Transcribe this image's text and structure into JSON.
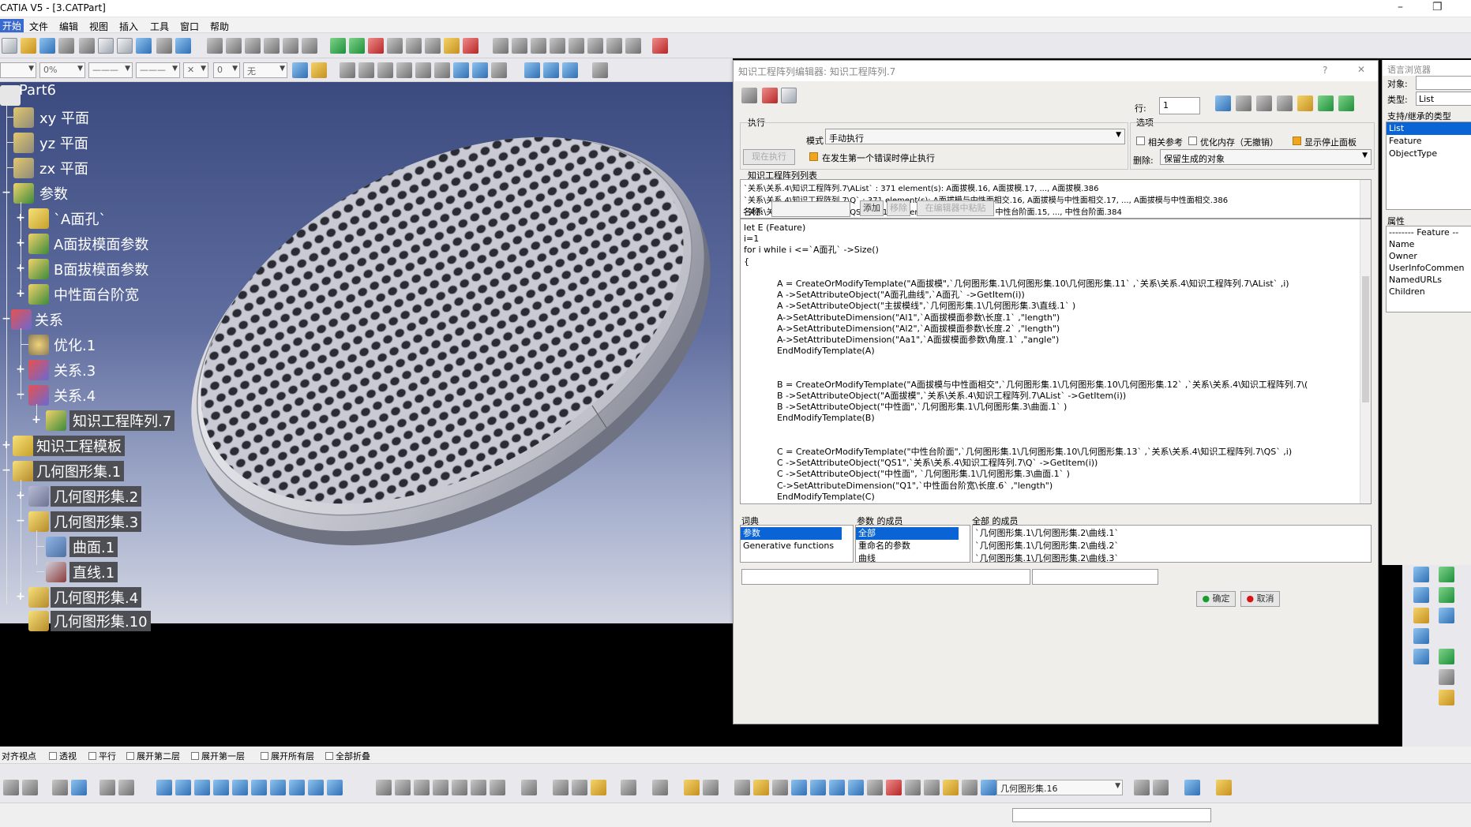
{
  "window": {
    "title": "CATIA V5 - [3.CATPart]"
  },
  "menu": [
    "开始",
    "文件",
    "编辑",
    "视图",
    "插入",
    "工具",
    "窗口",
    "帮助"
  ],
  "toolbar": {
    "opacity_value": "0%",
    "material_value": "无",
    "line_val": "0"
  },
  "tree": {
    "root": "Part6",
    "items": [
      {
        "label": "xy 平面"
      },
      {
        "label": "yz 平面"
      },
      {
        "label": "zx 平面"
      },
      {
        "label": "参数"
      },
      {
        "label": "`A面孔`"
      },
      {
        "label": "A面拔模面参数"
      },
      {
        "label": "B面拔模面参数"
      },
      {
        "label": "中性面台阶宽"
      },
      {
        "label": "关系"
      },
      {
        "label": "优化.1"
      },
      {
        "label": "关系.3"
      },
      {
        "label": "关系.4"
      },
      {
        "label": "知识工程阵列.7"
      },
      {
        "label": "知识工程模板"
      },
      {
        "label": "几何图形集.1"
      },
      {
        "label": "几何图形集.2"
      },
      {
        "label": "几何图形集.3"
      },
      {
        "label": "曲面.1"
      },
      {
        "label": "直线.1"
      },
      {
        "label": "几何图形集.4"
      },
      {
        "label": "几何图形集.10"
      }
    ]
  },
  "dialog": {
    "title": "知识工程阵列编辑器: 知识工程阵列.7",
    "help": "?",
    "close": "✕",
    "row_label": "行:",
    "row_value": "1",
    "exec_group": "执行",
    "mode_label": "模式",
    "mode_value": "手动执行",
    "run_now": "现在执行",
    "stop_on_error": "在发生第一个错误时停止执行",
    "options_group": "选项",
    "opt_related_ref": "相关参考",
    "opt_optimize_mem": "优化内存（无撤销）",
    "opt_show_stop": "显示停止面板",
    "delete_label": "删除:",
    "delete_value": "保留生成的对象",
    "list_group": "知识工程阵列列表",
    "list_rows": [
      "`关系\\关系.4\\知识工程阵列.7\\AList` : 371 element(s): A面拔模.16, A面拔模.17, ..., A面拔模.386",
      "`关系\\关系.4\\知识工程阵列.7\\Q` : 371 element(s): A面拔模与中性面相交.16, A面拔模与中性面相交.17, ..., A面拔模与中性面相交.386",
      "`关系\\关系.4\\知识工程阵列.7\\QS` : 371 element(s): 中性台阶面.14, 中性台阶面.15, ..., 中性台阶面.384"
    ],
    "name_label": "名称:",
    "add_btn": "添加",
    "remove_btn": "移除",
    "rename_btn": "在编辑器中粘贴",
    "code_lines": [
      "let E (Feature)",
      "i=1",
      "for i while i <=`A面孔` ->Size()",
      "{",
      "",
      "            A = CreateOrModifyTemplate(\"A面拔模\",`几何图形集.1\\几何图形集.10\\几何图形集.11` ,`关系\\关系.4\\知识工程阵列.7\\AList` ,i)",
      "            A ->SetAttributeObject(\"A面孔曲线\",`A面孔` ->GetItem(i))",
      "            A ->SetAttributeObject(\"主拔模线\",`几何图形集.1\\几何图形集.3\\直线.1` )",
      "            A->SetAttributeDimension(\"Al1\",`A面拔模面参数\\长度.1` ,\"length\")",
      "            A->SetAttributeDimension(\"Al2\",`A面拔模面参数\\长度.2` ,\"length\")",
      "            A->SetAttributeDimension(\"Aa1\",`A面拔模面参数\\角度.1` ,\"angle\")",
      "            EndModifyTemplate(A)",
      "",
      "",
      "            B = CreateOrModifyTemplate(\"A面拔模与中性面相交\",`几何图形集.1\\几何图形集.10\\几何图形集.12` ,`关系\\关系.4\\知识工程阵列.7\\(",
      "            B ->SetAttributeObject(\"A面拔模\",`关系\\关系.4\\知识工程阵列.7\\AList` ->GetItem(i))",
      "            B ->SetAttributeObject(\"中性面\",`几何图形集.1\\几何图形集.3\\曲面.1` )",
      "            EndModifyTemplate(B)",
      "",
      "",
      "            C = CreateOrModifyTemplate(\"中性台阶面\",`几何图形集.1\\几何图形集.10\\几何图形集.13` ,`关系\\关系.4\\知识工程阵列.7\\QS` ,i)",
      "            C ->SetAttributeObject(\"QS1\",`关系\\关系.4\\知识工程阵列.7\\Q` ->GetItem(i))",
      "            C ->SetAttributeObject(\"中性面\", `几何图形集.1\\几何图形集.3\\曲面.1` )",
      "            C->SetAttributeDimension(\"Q1\",`中性面台阶宽\\长度.6` ,\"length\")",
      "            EndModifyTemplate(C)"
    ],
    "dict_header": "词典",
    "dict_items": [
      "参数",
      "Generative functions"
    ],
    "members_header": "参数 的成员",
    "members_items": [
      "全部",
      "重命名的参数",
      "曲线"
    ],
    "all_members_header": "全部 的成员",
    "all_members_items": [
      "`几何图形集.1\\几何图形集.2\\曲线.1`",
      "`几何图形集.1\\几何图形集.2\\曲线.2`",
      "`几何图形集.1\\几何图形集.2\\曲线.3`"
    ],
    "ok": "确定",
    "cancel": "取消"
  },
  "browser": {
    "title": "语言浏览器",
    "object_label": "对象:",
    "type_label": "类型:",
    "type_value": "List",
    "supported_types": "支持/继承的类型",
    "types": [
      "List",
      "Feature",
      "ObjectType"
    ],
    "attributes": "属性",
    "attr_items": [
      "-------- Feature --",
      "Name",
      "Owner",
      "UserInfoCommen",
      "NamedURLs",
      "Children"
    ]
  },
  "options": [
    "对齐视点",
    "透视",
    "平行",
    "展开第二层",
    "展开第一层",
    "展开所有层",
    "全部折叠"
  ],
  "bottom": {
    "geoset_value": "几何图形集.16"
  }
}
